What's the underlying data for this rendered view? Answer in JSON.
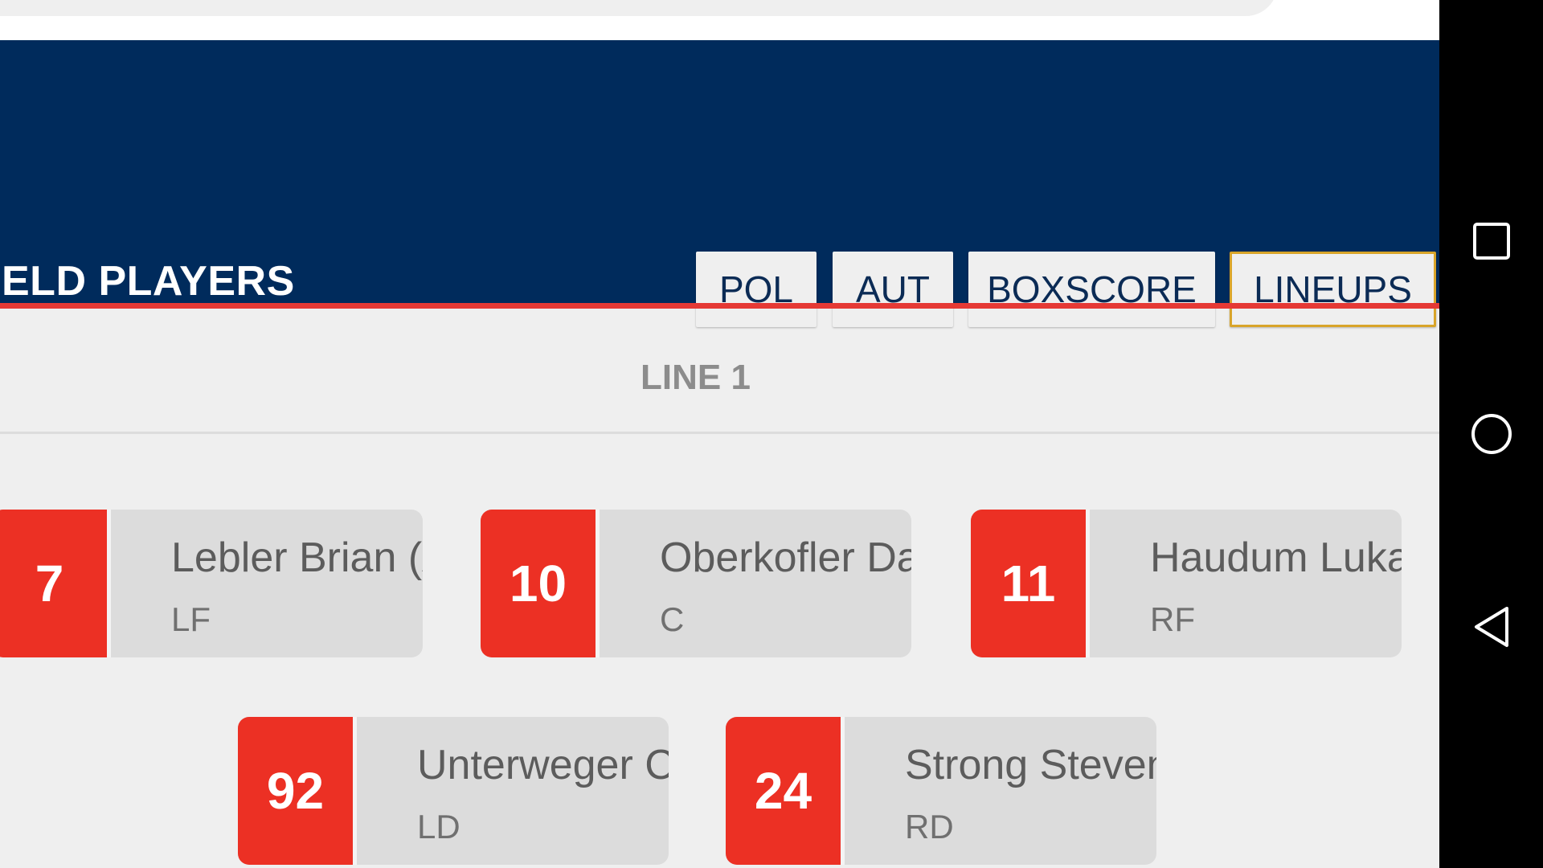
{
  "header": {
    "section_title": "ELD PLAYERS",
    "tabs": [
      {
        "label": "POL",
        "active": false
      },
      {
        "label": "AUT",
        "active": false
      },
      {
        "label": "BOXSCORE",
        "active": false
      },
      {
        "label": "LINEUPS",
        "active": true
      }
    ]
  },
  "lineup": {
    "title": "LINE 1",
    "players": [
      {
        "number": "7",
        "name": "Lebler Brian (A",
        "position": "LF"
      },
      {
        "number": "10",
        "name": "Oberkofler Da",
        "position": "C"
      },
      {
        "number": "11",
        "name": "Haudum Luka",
        "position": "RF"
      },
      {
        "number": "92",
        "name": "Unterweger C",
        "position": "LD"
      },
      {
        "number": "24",
        "name": "Strong Steven",
        "position": "RD"
      }
    ]
  },
  "navbar": {
    "icons": [
      "recent-apps-icon",
      "home-icon",
      "back-icon"
    ]
  },
  "colors": {
    "header_bg": "#002b5c",
    "accent_red": "#e53935",
    "number_red": "#ec3024",
    "active_tab_border": "#d8a42a"
  }
}
